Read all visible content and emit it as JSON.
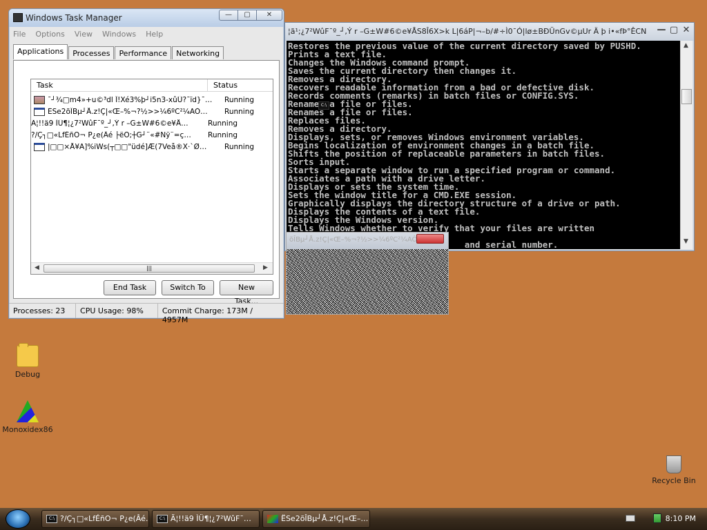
{
  "desktop": {
    "icons": [
      {
        "label": "Debug",
        "icon": "folder-icon"
      },
      {
        "label": "Monoxidex86",
        "icon": "app-icon"
      },
      {
        "label": "Recycle Bin",
        "icon": "recycle-bin-icon"
      }
    ]
  },
  "task_manager": {
    "title": "Windows Task Manager",
    "window_buttons": {
      "minimize": "—",
      "maximize": "▢",
      "close": "✕"
    },
    "menu": [
      "File",
      "Options",
      "View",
      "Windows",
      "Help"
    ],
    "tabs": [
      "Applications",
      "Processes",
      "Performance",
      "Networking"
    ],
    "columns": [
      "Task",
      "Status"
    ],
    "tasks": [
      {
        "task": "¯┘¾□m4»+u©³dl Î!Xé3%þ┘i5n3-xûÛ?¯ïd}¯…",
        "status": "Running",
        "icon": "img"
      },
      {
        "task": "ËSe2õÎBµ┘Å.z!Ç|«Œ–%¬?½>>¼6ºC²¼AÒ…",
        "status": "Running",
        "icon": "win"
      },
      {
        "task": "Ã¦!!ä9 ÌÜ¶¦¿7²WûF¯º_┘,Ý r –G±W#6©e¥Å…",
        "status": "Running",
        "icon": "cmd"
      },
      {
        "task": "?/Ç┐□«LfÉñO¬ P¿e(Âé ├ëÕ;┼G┘¨«#Nÿ¨=ç…",
        "status": "Running",
        "icon": "cmd"
      },
      {
        "task": "|□□×Å¥A]%iWs(┬□□\"üdé]Æ(7Veå®X·`Ø…",
        "status": "Running",
        "icon": "win"
      }
    ],
    "buttons": {
      "end_task": "End Task",
      "switch_to": "Switch To",
      "new_task": "New Task..."
    },
    "status": {
      "processes": "Processes: 23",
      "cpu": "CPU Usage: 98%",
      "commit": "Commit Charge: 173M / 4957M"
    }
  },
  "cmd_window": {
    "title": "¦ã¹;¿7²WûF¯º_┘,Ý r –G±W#6©e¥ÅS8Î6X>k L|6áP|¬–b/#÷Ì0¯Ó|lø±BÐÜnGv©µUr Ä þ i•«fÞ°ÊCN ├ <kÑ-…",
    "lines": [
      "Restores the previous value of the current directory saved by PUSHD.",
      "Prints a text file.",
      "Changes the Windows command prompt.",
      "Saves the current directory then changes it.",
      "Removes a directory.",
      "Recovers readable information from a bad or defective disk.",
      "Records comments (remarks) in batch files or CONFIG.SYS.",
      "Renames a file or files.",
      "Renames a file or files.",
      "Replaces files.",
      "Removes a directory.",
      "Displays, sets, or removes Windows environment variables.",
      "Begins localization of environment changes in a batch file.",
      "Shifts the position of replaceable parameters in batch files.",
      "Sorts input.",
      "Starts a separate window to run a specified program or command.",
      "Associates a path with a drive letter.",
      "Displays or sets the system time.",
      "Sets the window title for a CMD.EXE session.",
      "Graphically displays the directory structure of a drive or path.",
      "Displays the contents of a text file.",
      "Displays the Windows version.",
      "Tells Windows whether to verify that your files are written",
      "",
      "                                  and serial number."
    ]
  },
  "noise_window": {
    "title": "õÎBµ┘Å.z!Ç|«Œ–%¬?½>>¼6ºC²¼AÒ…"
  },
  "taskbar": {
    "buttons": [
      {
        "label": "?/Ç┐□«LfÉñO¬ P¿e(Âé…",
        "icon": "cmd"
      },
      {
        "label": "Ã¦!!ä9 ÌÜ¶¦¿7²WûF¯…",
        "icon": "cmd"
      },
      {
        "label": "ËSe2õÎBµ┘Å.z!Ç|«Œ–…",
        "icon": "paint"
      }
    ],
    "clock": "8:10 PM"
  }
}
